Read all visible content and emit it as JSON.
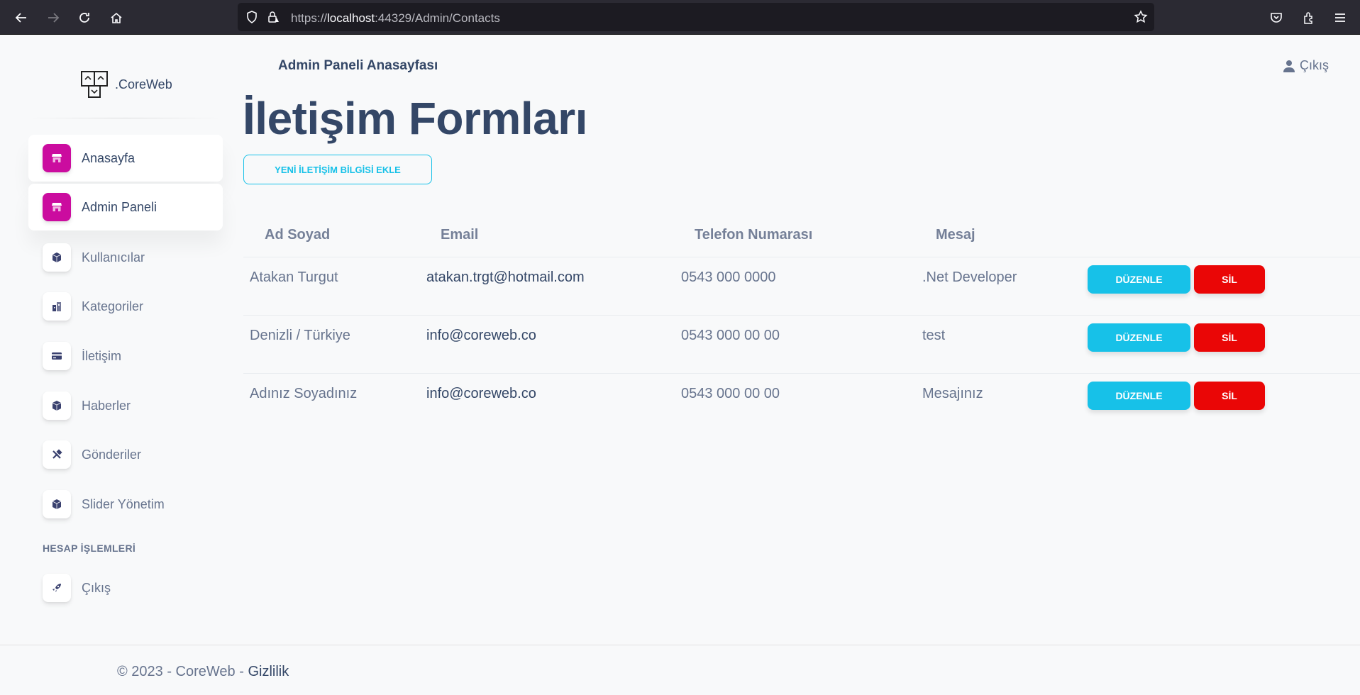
{
  "browser": {
    "url_prefix": "https://",
    "url_host": "localhost",
    "url_rest": ":44329/Admin/Contacts"
  },
  "sidebar": {
    "brand": ".CoreWeb",
    "items": [
      {
        "label": "Anasayfa",
        "icon": "shop-icon"
      },
      {
        "label": "Admin Paneli",
        "icon": "shop-icon"
      },
      {
        "label": "Kullanıcılar",
        "icon": "box-icon"
      },
      {
        "label": "Kategoriler",
        "icon": "office-icon"
      },
      {
        "label": "İletişim",
        "icon": "credit-card-icon"
      },
      {
        "label": "Haberler",
        "icon": "box-icon"
      },
      {
        "label": "Gönderiler",
        "icon": "tools-icon"
      },
      {
        "label": "Slider Yönetim",
        "icon": "box-icon"
      }
    ],
    "section_title": "HESAP İŞLEMLERİ",
    "logout_item": {
      "label": "Çıkış",
      "icon": "rocket-icon"
    }
  },
  "topbar": {
    "title": "Admin Paneli Anasayfası",
    "logout": "Çıkış"
  },
  "main": {
    "title": "İletişim Formları",
    "add_button": "YENİ İLETİŞİM BİLGİSİ EKLE",
    "columns": [
      "Ad Soyad",
      "Email",
      "Telefon Numarası",
      "Mesaj"
    ],
    "rows": [
      {
        "name": "Atakan Turgut",
        "email": "atakan.trgt@hotmail.com",
        "phone": "0543 000 0000",
        "message": ".Net Developer"
      },
      {
        "name": "Denizli / Türkiye",
        "email": "info@coreweb.co",
        "phone": "0543 000 00 00",
        "message": "test"
      },
      {
        "name": "Adınız Soyadınız",
        "email": "info@coreweb.co",
        "phone": "0543 000 00 00",
        "message": "Mesajınız"
      }
    ],
    "edit_label": "DÜZENLE",
    "delete_label": "SİL"
  },
  "footer": {
    "copyright": "© 2023 - CoreWeb - ",
    "privacy": "Gizlilik"
  },
  "colors": {
    "accent": "#cb0c9f",
    "info": "#17c1e8",
    "danger": "#ea0606",
    "text_dark": "#344767",
    "text_muted": "#67748e"
  }
}
